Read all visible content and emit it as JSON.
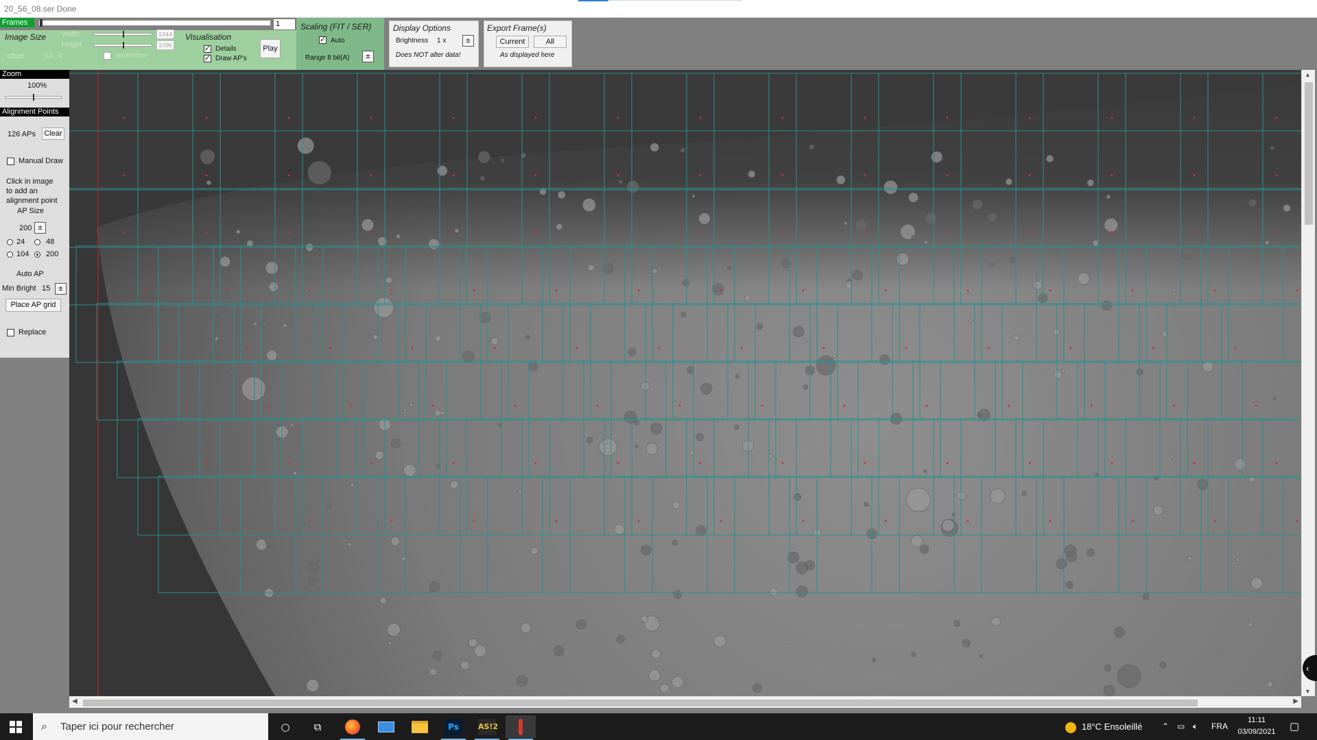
{
  "window": {
    "title": "20_56_08.ser  Done"
  },
  "frames": {
    "label": "Frames",
    "current": "1"
  },
  "image_size": {
    "title": "Image Size",
    "width_label": "Width",
    "width_value": "1944",
    "height_label": "Height",
    "height_value": "1096",
    "offset_label": "offset",
    "offset_value": "-13, -4",
    "remember_label": "remember"
  },
  "visualisation": {
    "title": "Visualisation",
    "details_label": "Details",
    "draw_aps_label": "Draw AP's",
    "play_label": "Play"
  },
  "scaling": {
    "title": "Scaling (FIT / SER)",
    "auto_label": "Auto",
    "range_label": "Range 8 bit(A)"
  },
  "display_options": {
    "title": "Display Options",
    "brightness_label": "Brightness",
    "brightness_value": "1 x",
    "note": "Does NOT alter data!"
  },
  "export": {
    "title": "Export Frame(s)",
    "current_label": "Current",
    "all_label": "All",
    "note": "As displayed here"
  },
  "zoom": {
    "header": "Zoom",
    "value": "100%"
  },
  "alignment": {
    "header": "Alignment Points",
    "count": "126 APs",
    "clear_label": "Clear",
    "manual_draw_label": "Manual Draw",
    "help_lines": [
      "Click in image",
      "to add an",
      "alignment point"
    ],
    "ap_size_label": "AP Size",
    "ap_size_value": "200",
    "sizes": [
      "24",
      "48",
      "104",
      "200"
    ],
    "selected_size": "200",
    "auto_ap_label": "Auto AP",
    "min_bright_label": "Min Bright",
    "min_bright_value": "15",
    "place_grid_label": "Place AP grid",
    "replace_label": "Replace"
  },
  "taskbar": {
    "search_placeholder": "Taper ici pour rechercher",
    "weather": "18°C  Ensoleillé",
    "language": "FRA",
    "time": "11:11",
    "date": "03/09/2021",
    "apps": [
      "cortana-icon",
      "task-view-icon",
      "firefox-icon",
      "mail-icon",
      "file-explorer-icon",
      "photoshop-icon",
      "as2-icon",
      "autostakkert-icon"
    ],
    "ps_label": "Ps",
    "as2_label": "AS!2"
  },
  "colors": {
    "green_panel": "#9ecf9e",
    "ap_grid": "#2a8f8f",
    "ap_dot": "#d03030",
    "guide_line": "#d02020",
    "taskbar": "#1c1c1c"
  }
}
